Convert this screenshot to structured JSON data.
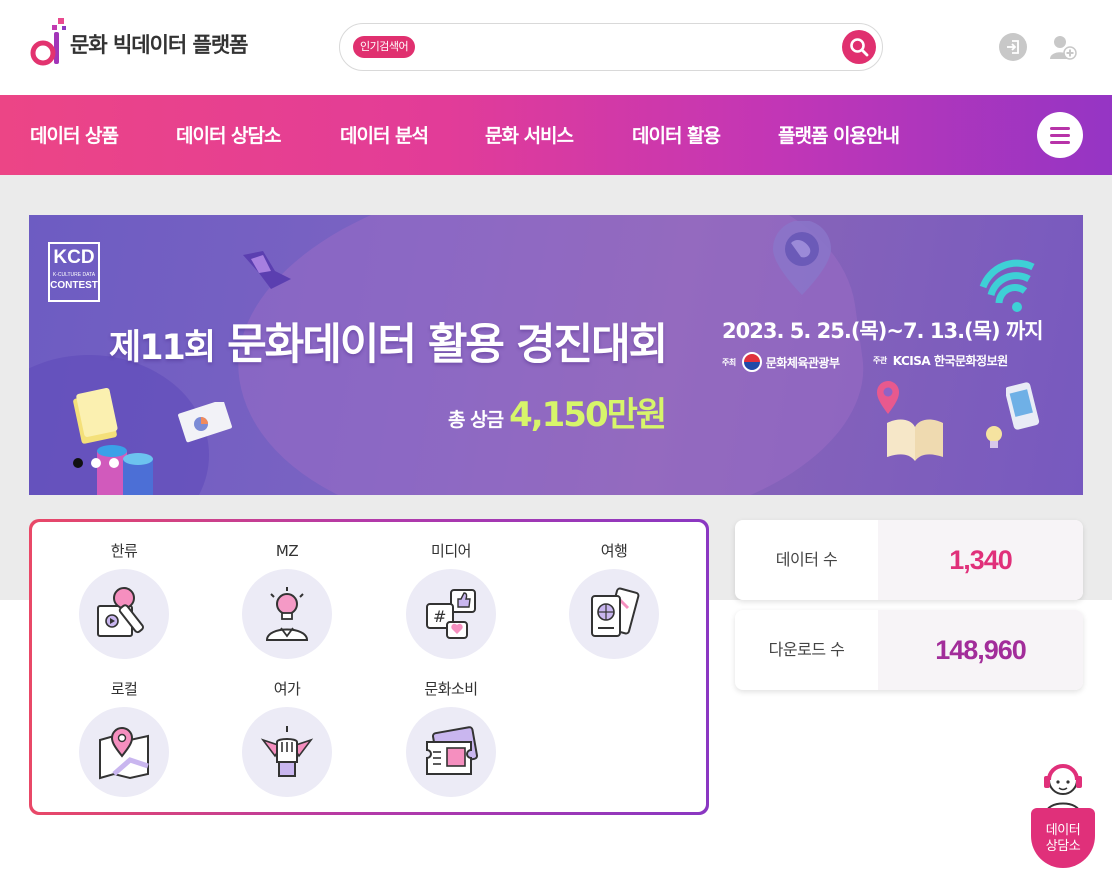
{
  "header": {
    "logo_text": "문화 빅데이터 플랫폼",
    "search_tag": "인기검색어",
    "search_value": ""
  },
  "nav": {
    "items": [
      "데이터 상품",
      "데이터 상담소",
      "데이터 분석",
      "문화 서비스",
      "데이터 활용",
      "플랫폼 이용안내"
    ]
  },
  "banner": {
    "logo_kcd": "KCD",
    "logo_sub": "K-CULTURE DATA",
    "logo_contest": "CONTEST",
    "title_lead": "제11회",
    "title_main": "문화데이터 활용 경진대회",
    "prize_label": "총 상금",
    "prize_amount": "4,150만원",
    "date": "2023. 5. 25.(목)~7. 13.(목) 까지",
    "host_label": "주최",
    "host": "문화체육관광부",
    "organizer_label": "주관",
    "organizer": "KCISA 한국문화정보원",
    "slide_count": 3,
    "active_slide": 1
  },
  "categories": [
    {
      "label": "한류",
      "icon": "microphone-icon"
    },
    {
      "label": "MZ",
      "icon": "lightbulb-person-icon"
    },
    {
      "label": "미디어",
      "icon": "social-media-icon"
    },
    {
      "label": "여행",
      "icon": "passport-ticket-icon"
    },
    {
      "label": "로컬",
      "icon": "map-pin-icon"
    },
    {
      "label": "여가",
      "icon": "raised-hands-icon"
    },
    {
      "label": "문화소비",
      "icon": "ticket-icon"
    }
  ],
  "stats": {
    "data_count_label": "데이터 수",
    "data_count": "1,340",
    "download_label": "다운로드 수",
    "download_count": "148,960"
  },
  "float_button": {
    "label_line1": "데이터",
    "label_line2": "상담소"
  },
  "colors": {
    "brand_pink": "#e0306f",
    "nav_gradient_start": "#ec4586",
    "nav_gradient_end": "#9535c4",
    "stat_pink": "#e0307a",
    "stat_purple": "#a22d9a"
  }
}
